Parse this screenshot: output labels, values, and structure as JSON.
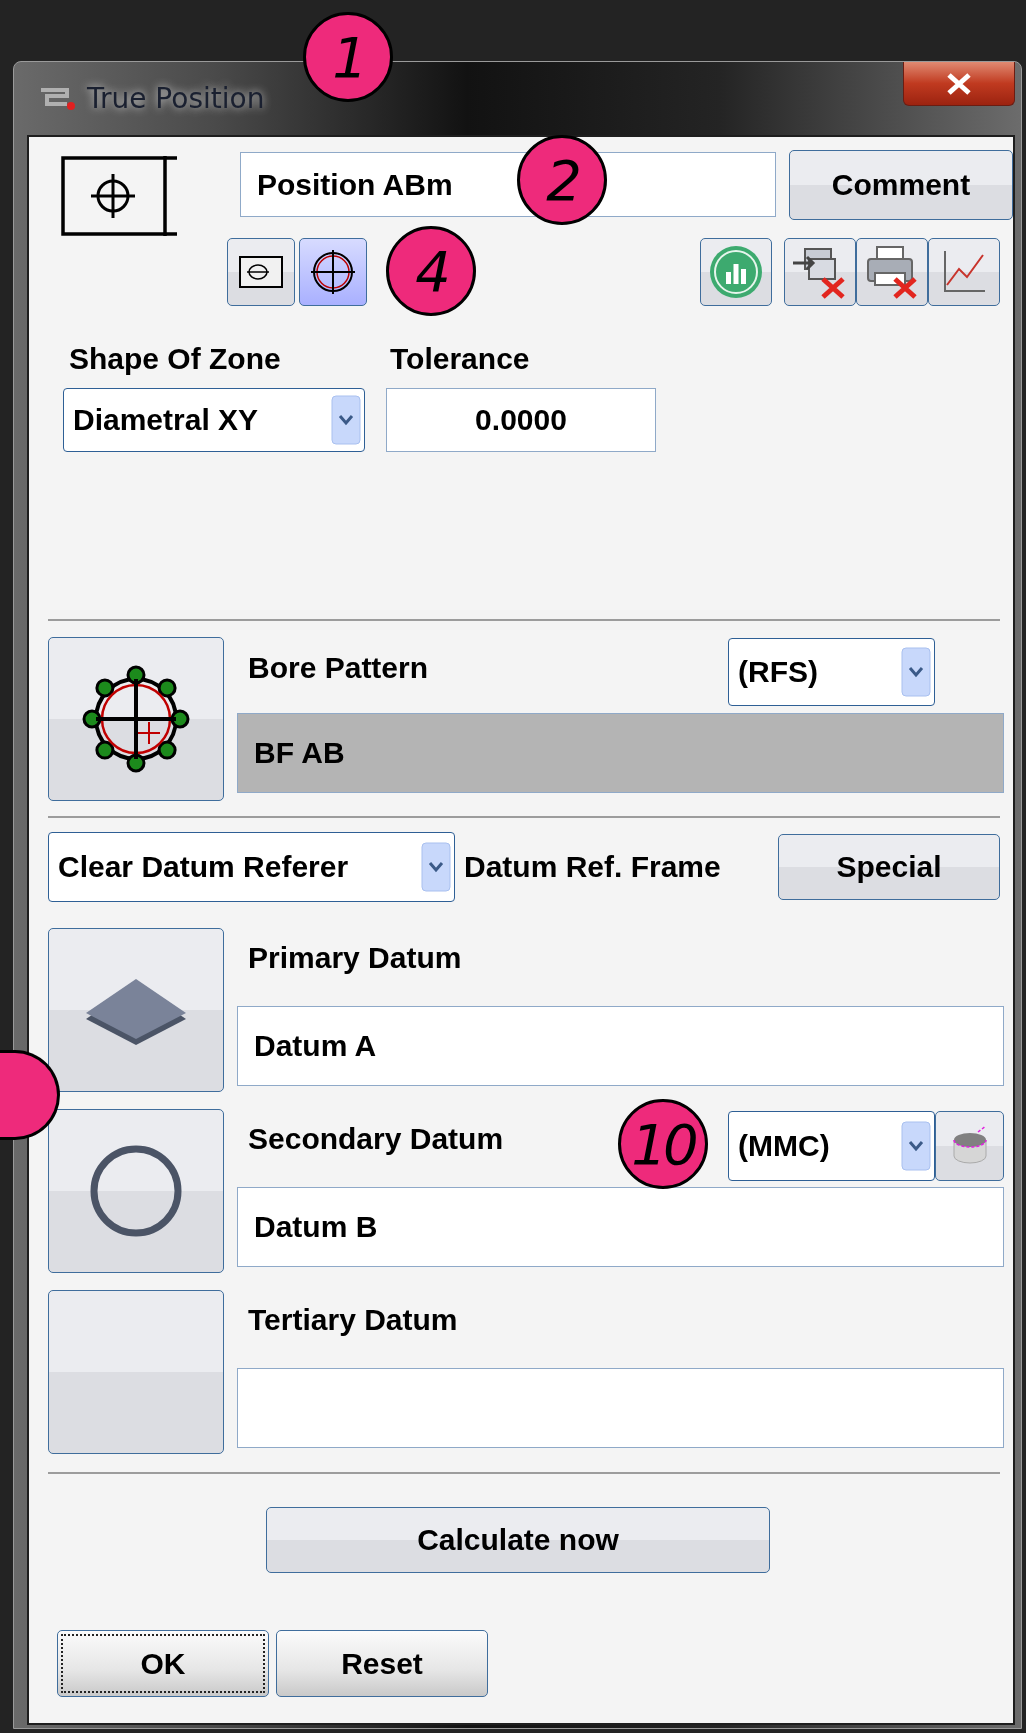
{
  "window": {
    "title": "True Position"
  },
  "callouts": [
    {
      "kind": "number",
      "label": "1"
    },
    {
      "kind": "number",
      "label": "2"
    },
    {
      "kind": "number",
      "label": "4"
    },
    {
      "kind": "number",
      "label": "10"
    },
    {
      "kind": "cut"
    }
  ],
  "feature": {
    "name": "Position ABm",
    "comment_button": "Comment"
  },
  "mode_buttons": [
    {
      "selected": false
    },
    {
      "selected": true
    }
  ],
  "shape_of_zone": {
    "label": "Shape Of Zone",
    "value": "Diametral XY"
  },
  "tolerance": {
    "label": "Tolerance",
    "value": "0.0000"
  },
  "feature_ref": {
    "label": "Bore Pattern",
    "modifier": "(RFS)",
    "value": "BF AB",
    "disabled": true
  },
  "datum_frame": {
    "selector": "Clear Datum Referer",
    "label": "Datum Ref. Frame",
    "button": "Special"
  },
  "datums": [
    {
      "kind": "plane",
      "label": "Primary Datum",
      "value": "Datum A"
    },
    {
      "kind": "circle",
      "label": "Secondary Datum",
      "value": "Datum B",
      "modifier": "(MMC)"
    },
    {
      "kind": "empty",
      "label": "Tertiary Datum"
    }
  ],
  "calculate_button": "Calculate now",
  "buttons": [
    {
      "label": "OK",
      "focused": true
    },
    {
      "label": "Reset",
      "focused": false
    }
  ]
}
